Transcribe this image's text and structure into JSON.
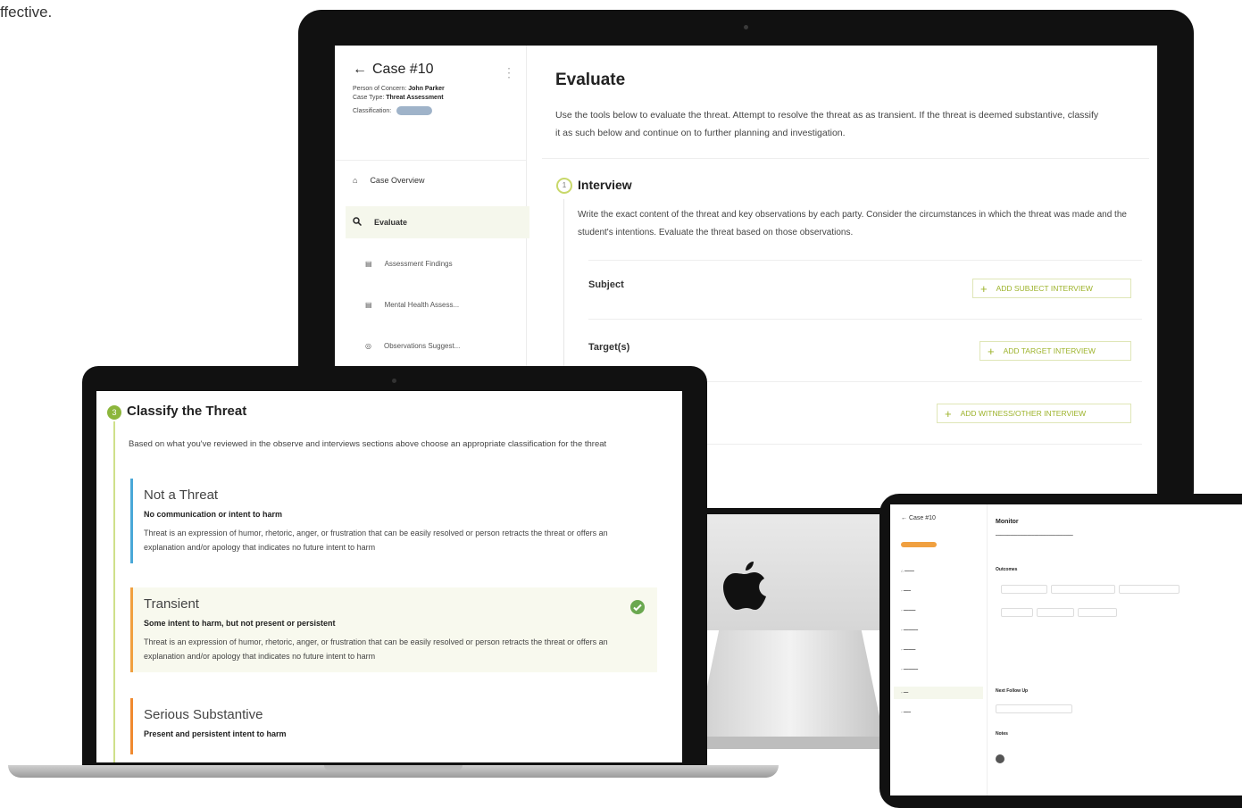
{
  "page_fragment": "ffective.",
  "imac": {
    "sidebar": {
      "back_title": "Case #10",
      "person_label": "Person of Concern:",
      "person_value": "John Parker",
      "casetype_label": "Case Type:",
      "casetype_value": "Threat Assessment",
      "classification_label": "Classification:",
      "nav": [
        {
          "label": "Case Overview",
          "icon": "home-icon"
        },
        {
          "label": "Evaluate",
          "icon": "search-icon"
        },
        {
          "label": "Assessment Findings",
          "icon": "clipboard-icon"
        },
        {
          "label": "Mental Health Assess...",
          "icon": "clipboard-icon"
        },
        {
          "label": "Observations Suggest...",
          "icon": "eye-icon"
        }
      ]
    },
    "main": {
      "title": "Evaluate",
      "description": "Use the tools below to evaluate the threat. Attempt to resolve the threat as as transient. If the threat is deemed substantive, classify it as such below and continue on to further planning and investigation.",
      "interview": {
        "step": "1",
        "title": "Interview",
        "description": "Write the exact content of the threat and key observations by each party. Consider the circumstances in which the threat was made and the student's intentions. Evaluate the threat based on those observations.",
        "rows": [
          {
            "label": "Subject",
            "button": "ADD SUBJECT INTERVIEW"
          },
          {
            "label": "Target(s)",
            "button": "ADD TARGET INTERVIEW"
          },
          {
            "label": "",
            "button": "ADD WITNESS/OTHER INTERVIEW"
          }
        ]
      }
    }
  },
  "macbook": {
    "step": "3",
    "title": "Classify the Threat",
    "description": "Based on what you've reviewed in the observe and interviews sections above choose an appropriate classification for the threat",
    "options": [
      {
        "title": "Not a Threat",
        "subtitle": "No communication or intent to harm",
        "text": "Threat is an expression of humor, rhetoric, anger, or frustration that can be easily resolved or person retracts the threat or offers an explanation and/or apology that indicates no future intent to harm",
        "color": "#4aa8d8"
      },
      {
        "title": "Transient",
        "subtitle": "Some intent to harm, but not present or persistent",
        "text": "Threat is an expression of humor, rhetoric, anger, or frustration that can be easily resolved or person retracts the threat or offers an explanation and/or apology that indicates no future intent to harm",
        "color": "#f0a040",
        "selected": true
      },
      {
        "title": "Serious Substantive",
        "subtitle": "Present and persistent intent to harm",
        "text": "",
        "color": "#f08a30"
      }
    ]
  },
  "ipad": {
    "back_title": "Case #10",
    "main_title": "Monitor",
    "section_outcomes": "Outcomes",
    "section_followup": "Next Follow Up",
    "section_notes": "Notes"
  },
  "colors": {
    "accent_green": "#9db32b",
    "step_green": "#8cb63c",
    "check_green": "#6aa84f"
  }
}
